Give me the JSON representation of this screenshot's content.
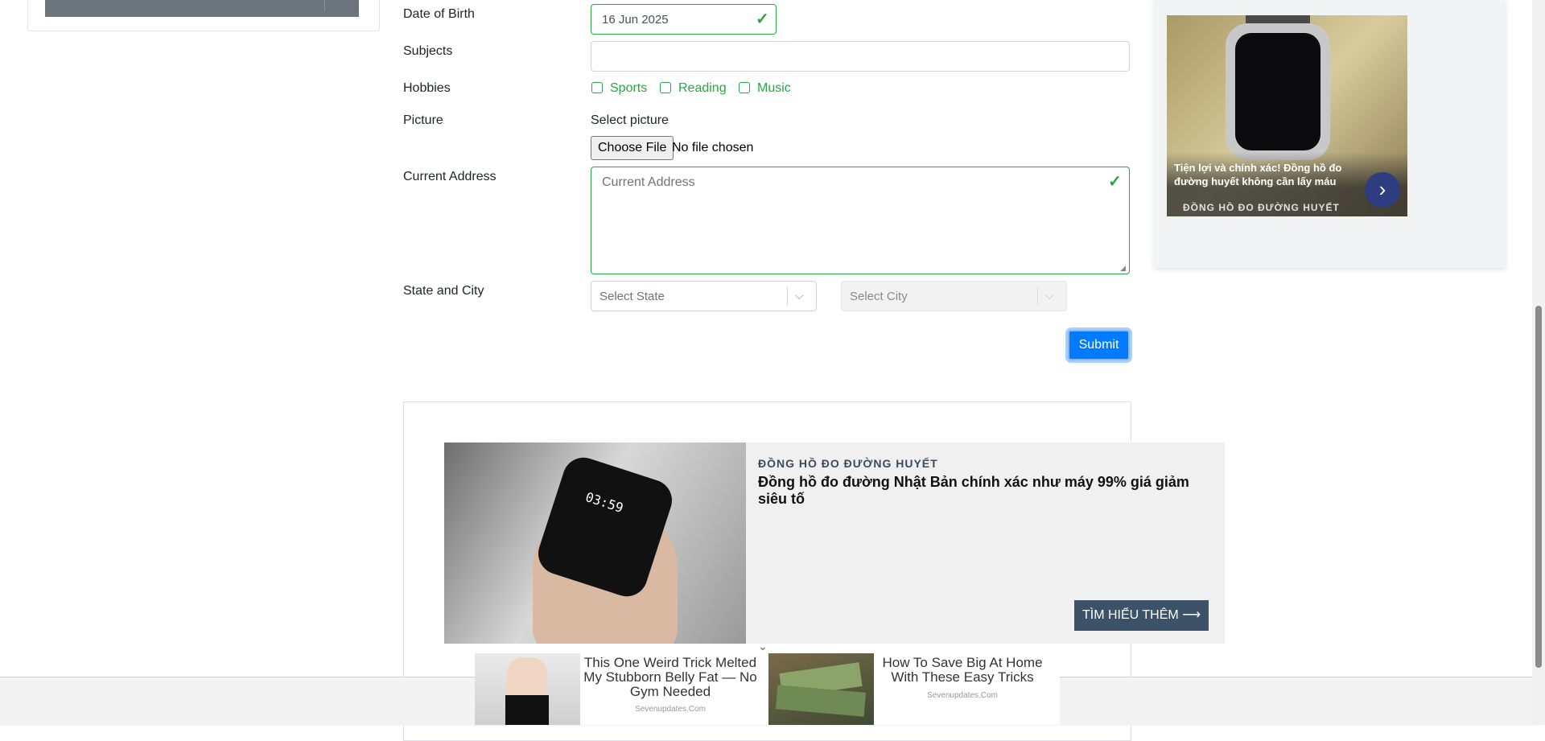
{
  "form": {
    "dob": {
      "label": "Date of Birth",
      "value": "16 Jun 2025"
    },
    "subjects": {
      "label": "Subjects",
      "value": ""
    },
    "hobbies": {
      "label": "Hobbies",
      "options": [
        {
          "label": "Sports",
          "checked": false
        },
        {
          "label": "Reading",
          "checked": false
        },
        {
          "label": "Music",
          "checked": false
        }
      ]
    },
    "picture": {
      "label": "Picture",
      "caption": "Select picture",
      "button": "Choose File",
      "status": "No file chosen"
    },
    "address": {
      "label": "Current Address",
      "placeholder": "Current Address"
    },
    "state_city": {
      "label": "State and City",
      "state_placeholder": "Select State",
      "city_placeholder": "Select City"
    },
    "submit": "Submit"
  },
  "side_ad": {
    "text": "Tiện lợi và chính xác! Đồng hồ đo đường huyết không cần lấy máu",
    "brand": "ĐỒNG HỒ ĐO ĐƯỜNG HUYẾT",
    "arrow_icon": "chevron-right-icon"
  },
  "main_ad": {
    "brand": "ĐỒNG HỒ ĐO ĐƯỜNG HUYẾT",
    "title": "Đồng hồ đo đường Nhật Bản chính xác như máy 99% giá giảm siêu tố",
    "cta": "TÌM HIỂU THÊM ⟶",
    "watch_time": "03:59"
  },
  "sticky_ad": {
    "items": [
      {
        "title": "This One Weird Trick Melted My Stubborn Belly Fat — No Gym Needed",
        "source": "Sevenupdates.Com"
      },
      {
        "title": "How To Save Big At Home With These Easy Tricks",
        "source": "Sevenupdates.Com"
      }
    ]
  },
  "colors": {
    "valid": "#28a745",
    "primary": "#007bff",
    "cta": "#3b5268"
  }
}
